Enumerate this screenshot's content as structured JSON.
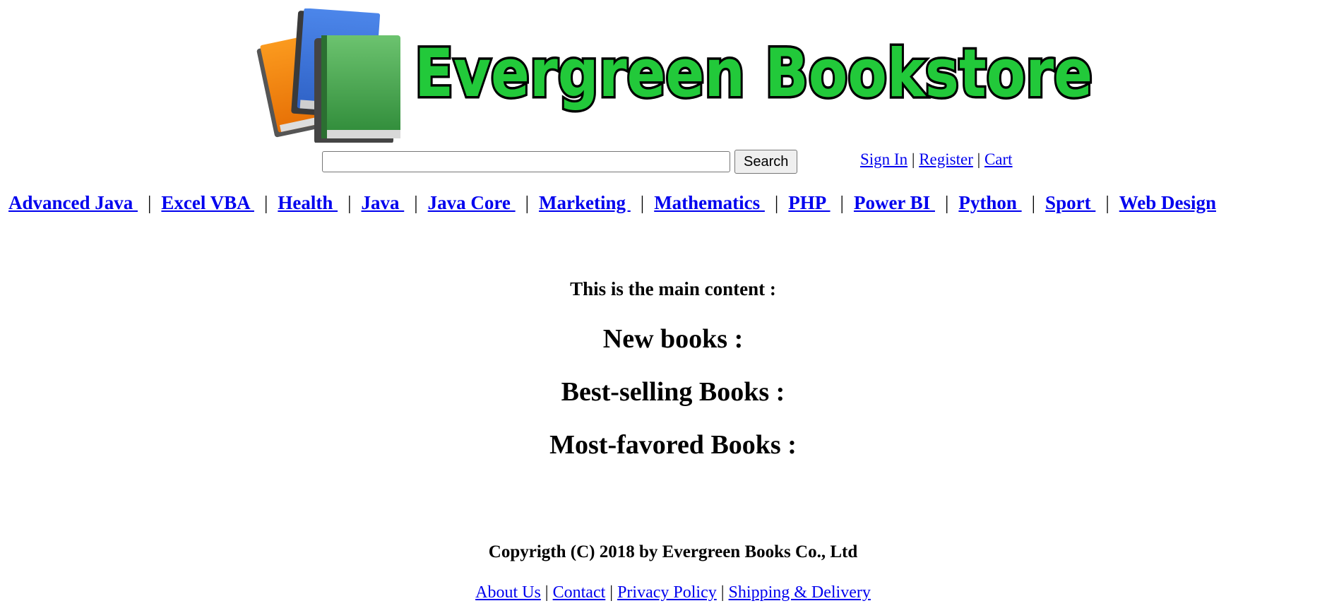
{
  "header": {
    "site_name": "Evergreen Bookstore",
    "logo_icon": "books-stack-icon",
    "colors": {
      "logo_text_fill": "#22c93a",
      "logo_text_stroke": "#000000",
      "book_orange": "#f7890f",
      "book_blue": "#3f7de0",
      "book_green": "#3d9a47"
    }
  },
  "search": {
    "value": "",
    "placeholder": "",
    "button_label": "Search"
  },
  "account": {
    "sign_in": "Sign In",
    "register": "Register",
    "cart": "Cart",
    "separator": "|"
  },
  "categories": {
    "separator": "|",
    "items": [
      "Advanced Java ",
      "Excel VBA ",
      "Health ",
      "Java ",
      "Java Core ",
      "Marketing ",
      "Mathematics ",
      "PHP ",
      "Power BI ",
      "Python ",
      "Sport ",
      "Web Design"
    ]
  },
  "main": {
    "intro": "This is the main content :",
    "new_books": "New books :",
    "best_selling": "Best-selling Books :",
    "most_favored": "Most-favored Books :"
  },
  "footer": {
    "copyright": "Copyrigth (C) 2018 by Evergreen Books Co., Ltd",
    "separator": "|",
    "links": {
      "about": "About Us",
      "contact": "Contact",
      "privacy": "Privacy Policy",
      "shipping": "Shipping & Delivery"
    }
  }
}
